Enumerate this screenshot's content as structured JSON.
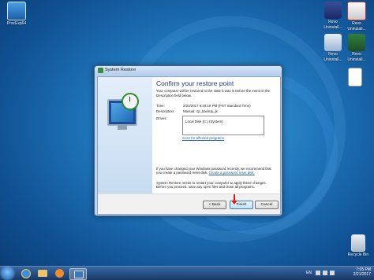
{
  "desktop": {
    "icons": [
      {
        "label": "ProcExp64"
      },
      {
        "label_line1": "Revo",
        "label_line2": "Uninstall..."
      },
      {
        "label_line1": "Revo",
        "label_line2": "Uninstall..."
      },
      {
        "label_line1": "Revo",
        "label_line2": "Uninstall..."
      },
      {
        "label_line1": "Revo",
        "label_line2": "Uninstall..."
      },
      {
        "label": "Recycle Bin"
      }
    ]
  },
  "dialog": {
    "window_title": "System Restore",
    "heading": "Confirm your restore point",
    "description": "Your computer will be restored to the state it was in before the event in the Description field below.",
    "time_label": "Time:",
    "time_value": "2/21/2017 6:34:18 PM (PST Standard Time)",
    "description_label": "Description:",
    "description_value": "Manual: cp_backup_jk",
    "drives_label": "Drives:",
    "drive_item": "Local Disk (C:) (System)",
    "scan_link": "Scan for affected programs",
    "password_note_prefix": "If you have changed your Windows password recently, we recommend that you create a password reset disk.",
    "password_link": "Create a password reset disk.",
    "restart_note": "System Restore needs to restart your computer to apply these changes. Before you proceed, save any open files and close all programs.",
    "buttons": {
      "back": "< Back",
      "finish": "Finish",
      "cancel": "Cancel"
    }
  },
  "taskbar": {
    "language": "EN",
    "time": "7:05 PM",
    "date": "2/21/2017"
  }
}
